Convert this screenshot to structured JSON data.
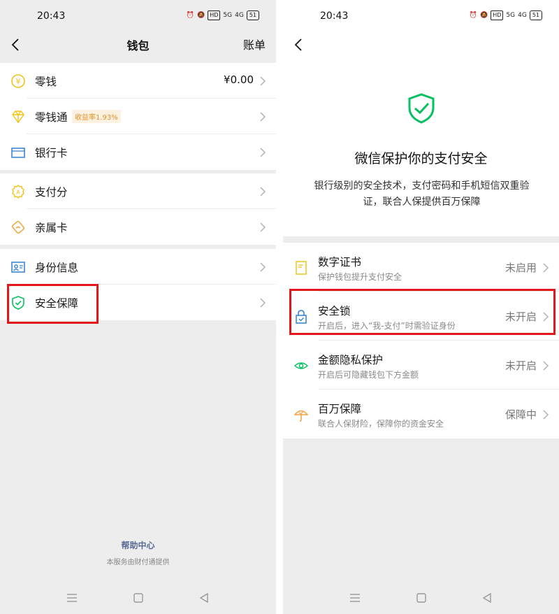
{
  "status": {
    "time": "20:43",
    "icon_text": [
      "HD",
      "5G",
      "4G",
      "51"
    ]
  },
  "wallet": {
    "title": "钱包",
    "bill_label": "账单",
    "group1": [
      {
        "icon": "yen-icon",
        "label": "零钱",
        "value": "¥0.00"
      },
      {
        "icon": "diamond-icon",
        "label": "零钱通",
        "badge": "收益率1.93%"
      },
      {
        "icon": "bank-card-icon",
        "label": "银行卡"
      }
    ],
    "group2": [
      {
        "icon": "pay-score-icon",
        "label": "支付分"
      },
      {
        "icon": "family-card-icon",
        "label": "亲属卡"
      }
    ],
    "group3": [
      {
        "icon": "id-card-icon",
        "label": "身份信息"
      },
      {
        "icon": "shield-icon",
        "label": "安全保障"
      }
    ],
    "help_title": "帮助中心",
    "help_sub": "本服务由财付通提供"
  },
  "security": {
    "title": "微信保护你的支付安全",
    "description": "银行级别的安全技术，支付密码和手机短信双重验证，联合人保提供百万保障",
    "items": [
      {
        "icon": "certificate-icon",
        "title": "数字证书",
        "subtitle": "保护钱包提升支付安全",
        "status": "未启用"
      },
      {
        "icon": "lock-icon",
        "title": "安全锁",
        "subtitle": "开启后，进入“我-支付”时需验证身份",
        "status": "未开启"
      },
      {
        "icon": "eye-icon",
        "title": "金额隐私保护",
        "subtitle": "开启后可隐藏钱包下方金额",
        "status": "未开启"
      },
      {
        "icon": "umbrella-icon",
        "title": "百万保障",
        "subtitle": "联合人保财险，保障你的资金安全",
        "status": "保障中"
      }
    ]
  },
  "colors": {
    "accent_green": "#07c160",
    "highlight_red": "#e3161b",
    "link_blue": "#576b95",
    "icon_yellow": "#f0c419",
    "icon_blue": "#2f7fd6",
    "icon_orange": "#f2a33a"
  }
}
